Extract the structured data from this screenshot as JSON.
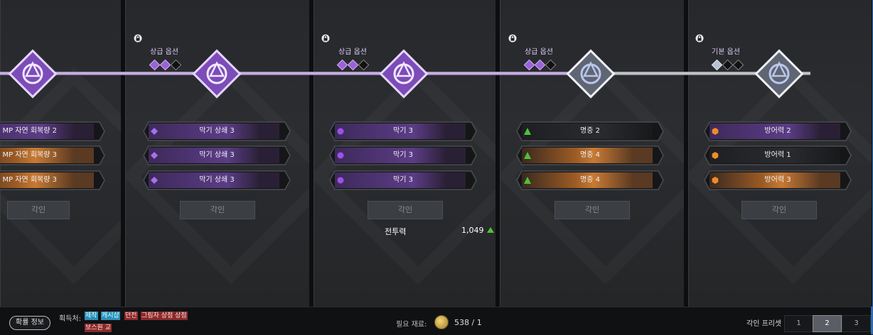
{
  "columns": [
    {
      "option_label": "",
      "gems": [],
      "engrave_label": "각인",
      "options": [
        {
          "text": "MP 자연 회복량 2",
          "style": "purple",
          "icon": "diamond-icon"
        },
        {
          "text": "MP 자연 회복량 3",
          "style": "orange",
          "icon": "diamond-icon"
        },
        {
          "text": "MP 자연 회복량 3",
          "style": "orange",
          "icon": "diamond-icon"
        }
      ]
    },
    {
      "option_label": "상급 옵션",
      "gems": [
        "on",
        "on",
        "off"
      ],
      "engrave_label": "각인",
      "options": [
        {
          "text": "막기 상쇄 3",
          "style": "purple",
          "icon": "diamond-icon"
        },
        {
          "text": "막기 상쇄 3",
          "style": "purple",
          "icon": "diamond-icon"
        },
        {
          "text": "막기 상쇄 3",
          "style": "purple",
          "icon": "diamond-icon"
        }
      ]
    },
    {
      "option_label": "상급 옵션",
      "gems": [
        "on",
        "on",
        "off"
      ],
      "engrave_label": "각인",
      "options": [
        {
          "text": "막기 3",
          "style": "purple",
          "icon": "circle-icon"
        },
        {
          "text": "막기 3",
          "style": "purple",
          "icon": "circle-icon"
        },
        {
          "text": "막기 3",
          "style": "purple",
          "icon": "circle-icon"
        }
      ]
    },
    {
      "option_label": "상급 옵션",
      "gems": [
        "on",
        "on",
        "off"
      ],
      "engrave_label": "각인",
      "options": [
        {
          "text": "명중 2",
          "style": "dark",
          "icon": "triangle-icon"
        },
        {
          "text": "명중 4",
          "style": "orange",
          "icon": "triangle-icon"
        },
        {
          "text": "명중 4",
          "style": "orange",
          "icon": "triangle-icon"
        }
      ]
    },
    {
      "option_label": "기본 옵션",
      "gems": [
        "silver",
        "off",
        "off"
      ],
      "engrave_label": "각인",
      "options": [
        {
          "text": "방어력 2",
          "style": "purple",
          "icon": "hexagon-icon"
        },
        {
          "text": "방어력 1",
          "style": "dark",
          "icon": "hexagon-icon"
        },
        {
          "text": "방어력 3",
          "style": "orange",
          "icon": "hexagon-icon"
        }
      ]
    }
  ],
  "combat_power": {
    "label": "전투력",
    "value": "1,049"
  },
  "footer": {
    "probability_button": "확률 정보",
    "source_label": "획득처:",
    "sources": [
      "제작",
      "캐시샵",
      "던전",
      "그림자 상점 상점",
      "보스원 교"
    ],
    "material_label": "필요 재료:",
    "material_value": "538 / 1",
    "preset_label": "각인 프리셋",
    "presets": [
      "1",
      "2",
      "3"
    ],
    "active_preset": "2"
  },
  "colors": {
    "purple": "#6b3fa0",
    "orange": "#b86a24",
    "accent_green": "#4cc33a",
    "frame_blue": "#2a6fb0"
  }
}
